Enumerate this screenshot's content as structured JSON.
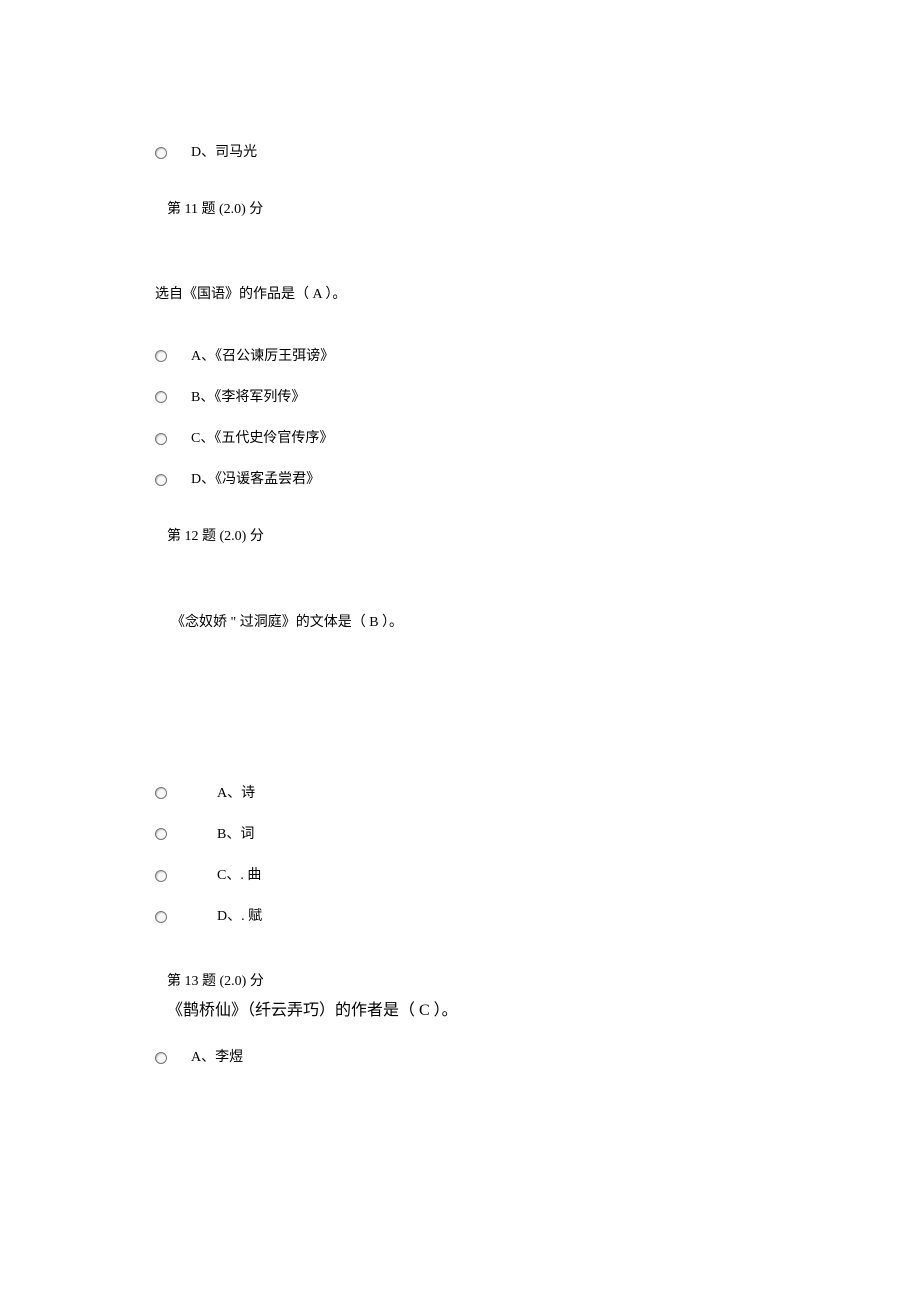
{
  "q10_remainder": {
    "option_d": "D、司马光"
  },
  "q11": {
    "header": "第 11 题 (2.0) 分",
    "stem": "选自《国语》的作品是（    A    ）。",
    "options": {
      "a": "A、《召公谏厉王弭谤》",
      "b": "B、《李将军列传》",
      "c": "C、《五代史伶官传序》",
      "d": "D、《冯谖客孟尝君》"
    }
  },
  "q12": {
    "header": "第 12 题 (2.0) 分",
    "stem": "《念奴娇 \" 过洞庭》的文体是（   B    ）。",
    "options": {
      "a": "A、诗",
      "b": "B、词",
      "c": "C、. 曲",
      "d": "D、. 赋"
    }
  },
  "q13": {
    "header": "第 13 题 (2.0) 分",
    "stem": "《鹊桥仙》（纤云弄巧）的作者是（ C  ）。",
    "options": {
      "a": "A、李煜"
    }
  }
}
